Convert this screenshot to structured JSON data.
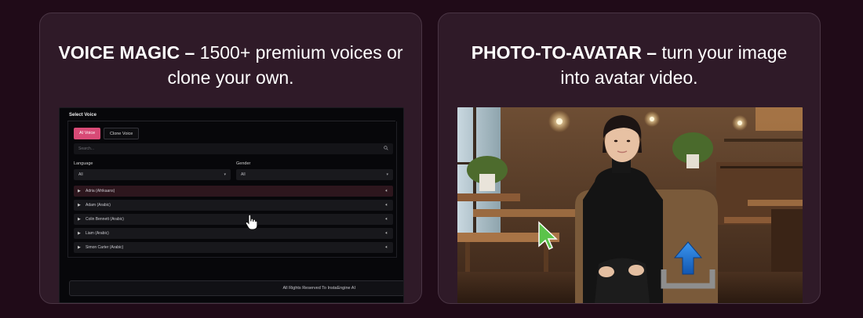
{
  "cards": [
    {
      "title_bold": "VOICE MAGIC –",
      "title_rest": " 1500+ premium voices or clone your own."
    },
    {
      "title_bold": "PHOTO-TO-AVATAR –",
      "title_rest": " turn your image into avatar video."
    }
  ],
  "voice_panel": {
    "header": "Select Voice",
    "tabs": [
      "AI Voice",
      "Clone Voice"
    ],
    "search_placeholder": "Search...",
    "language_label": "Language",
    "language_value": "All",
    "gender_label": "Gender",
    "gender_value": "All",
    "voices": [
      "Adria (Afrikaans)",
      "Adam (Arabic)",
      "Colin Bennett (Arabic)",
      "Liam (Arabic)",
      "Simon Carter (Arabic)"
    ],
    "footer": "All Rights Reserved To InstaEngine AI"
  },
  "icons": {
    "search": "search-icon",
    "play": "play-icon",
    "speaker": "speaker-icon",
    "chevron": "chevron-down-icon",
    "hand_cursor": "hand-cursor-icon",
    "arrow_cursor": "arrow-cursor-icon",
    "upload": "upload-icon"
  },
  "colors": {
    "page_bg": "#200b18",
    "card_bg": "#2f1a28",
    "accent": "#d84a76",
    "upload_blue": "#1e73d6"
  }
}
